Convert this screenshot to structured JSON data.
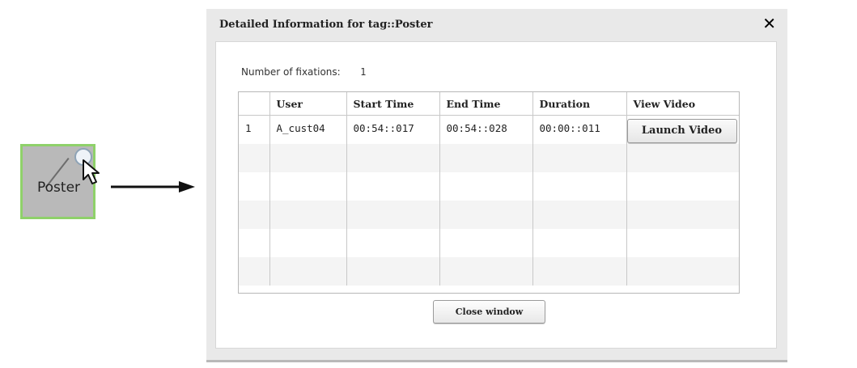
{
  "tag_node": {
    "label": "Poster",
    "border_color": "#8fd16a",
    "fill_color": "#b9b9b9"
  },
  "dialog": {
    "title": "Detailed Information for tag::Poster",
    "close_icon": "close-icon",
    "fixations_label": "Number of fixations:",
    "fixations_count": "1",
    "columns": [
      "",
      "User",
      "Start Time",
      "End Time",
      "Duration",
      "View Video"
    ],
    "rows": [
      {
        "index": "1",
        "user": "A_cust04",
        "start": "00:54::017",
        "end": "00:54::028",
        "duration": "00:00::011",
        "action": "Launch Video"
      }
    ],
    "close_button": "Close window"
  }
}
